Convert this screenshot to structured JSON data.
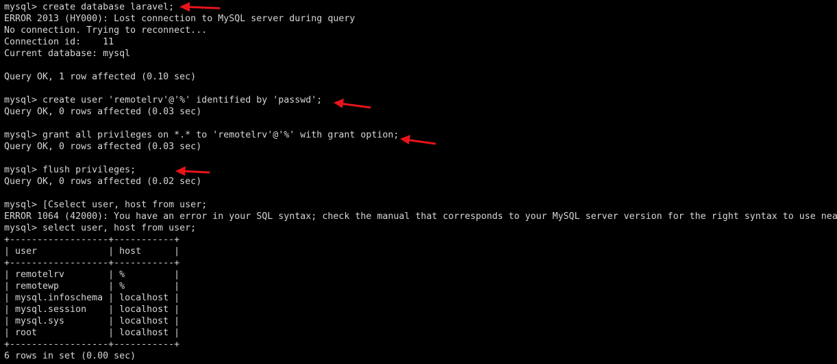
{
  "terminal": {
    "lines": [
      "mysql> create database laravel;",
      "ERROR 2013 (HY000): Lost connection to MySQL server during query",
      "No connection. Trying to reconnect...",
      "Connection id:    11",
      "Current database: mysql",
      "",
      "Query OK, 1 row affected (0.10 sec)",
      "",
      "mysql> create user 'remotelrv'@'%' identified by 'passwd';",
      "Query OK, 0 rows affected (0.03 sec)",
      "",
      "mysql> grant all privileges on *.* to 'remotelrv'@'%' with grant option;",
      "Query OK, 0 rows affected (0.03 sec)",
      "",
      "mysql> flush privileges;",
      "Query OK, 0 rows affected (0.02 sec)",
      "",
      "mysql> [Cselect user, host from user;",
      "ERROR 1064 (42000): You have an error in your SQL syntax; check the manual that corresponds to your MySQL server version for the right syntax to use nea",
      "mysql> select user, host from user;",
      "+------------------+-----------+",
      "| user             | host      |",
      "+------------------+-----------+",
      "| remotelrv        | %         |",
      "| remotewp         | %         |",
      "| mysql.infoschema | localhost |",
      "| mysql.session    | localhost |",
      "| mysql.sys        | localhost |",
      "| root             | localhost |",
      "+------------------+-----------+",
      "6 rows in set (0.00 sec)"
    ]
  },
  "annotations": {
    "arrow_color": "#e8141b",
    "arrow_lines": [
      0,
      8,
      11,
      14
    ]
  },
  "colors": {
    "background": "#000000",
    "text": "#d6d6d6"
  }
}
